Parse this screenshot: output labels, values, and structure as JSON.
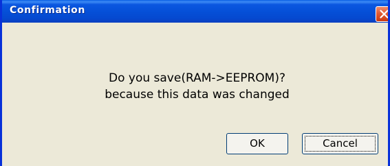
{
  "window": {
    "title": "Confirmation"
  },
  "message": {
    "line1": "Do you save(RAM->EEPROM)?",
    "line2": "because this data was changed"
  },
  "buttons": {
    "ok_label": "OK",
    "cancel_label": "Cancel"
  },
  "icons": {
    "close": "close-icon"
  },
  "colors": {
    "titlebar": "#0550d8",
    "close_button": "#e25b34",
    "window_background": "#ece9d8",
    "button_border": "#003c74"
  }
}
